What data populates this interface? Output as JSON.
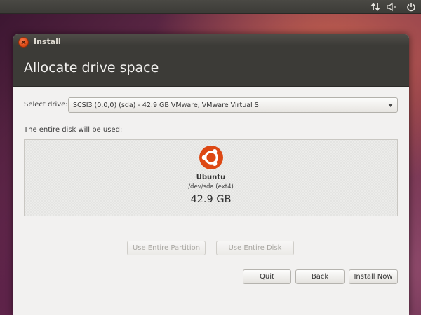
{
  "window": {
    "title": "Install",
    "heading": "Allocate drive space"
  },
  "panel": {
    "icons": [
      "network-updown-icon",
      "volume-icon",
      "power-icon"
    ]
  },
  "drive": {
    "label": "Select drive:",
    "selected": "SCSI3 (0,0,0) (sda) - 42.9 GB VMware, VMware Virtual S"
  },
  "disk": {
    "label": "The entire disk will be used:",
    "os_name": "Ubuntu",
    "device": "/dev/sda (ext4)",
    "size": "42.9 GB"
  },
  "buttons": {
    "use_entire_partition": "Use Entire Partition",
    "use_entire_disk": "Use Entire Disk",
    "quit": "Quit",
    "back": "Back",
    "install_now": "Install Now"
  },
  "colors": {
    "panel": "#3c3b37",
    "titlebar": "#3c3b37",
    "window_bg": "#f2f1f0",
    "ubuntu_orange": "#dd4814",
    "close_button": "#df4b16"
  }
}
